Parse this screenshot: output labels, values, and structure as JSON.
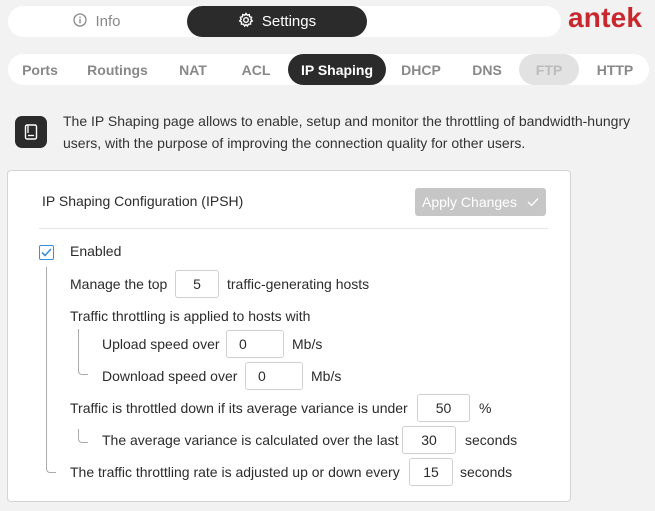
{
  "top_tabs": [
    {
      "label": "Info",
      "icon": "info-icon"
    },
    {
      "label": "Settings",
      "icon": "gear-icon"
    }
  ],
  "brand": "antek",
  "colors": {
    "accent": "#c6282e",
    "dark": "#2b2b2b",
    "check": "#3b8fd9"
  },
  "sub_tabs": [
    "Ports",
    "Routings",
    "NAT",
    "ACL",
    "IP Shaping",
    "DHCP",
    "DNS",
    "FTP",
    "HTTP"
  ],
  "active_sub_tab": "IP Shaping",
  "disabled_sub_tab": "FTP",
  "description": "The IP Shaping page allows to enable, setup and monitor the throttling of bandwidth-hungry users, with the purpose of improving the connection quality for other users.",
  "config": {
    "title": "IP Shaping Configuration (IPSH)",
    "apply_label": "Apply Changes",
    "enabled_label": "Enabled",
    "enabled": true,
    "top_prefix": "Manage the top",
    "top_value": "5",
    "top_suffix": "traffic-generating hosts",
    "throttle_label": "Traffic throttling is applied to hosts with",
    "upload_label": "Upload speed over",
    "upload_value": "0",
    "upload_unit": "Mb/s",
    "download_label": "Download speed over",
    "download_value": "0",
    "download_unit": "Mb/s",
    "variance_label": "Traffic is throttled down if its average variance is under",
    "variance_value": "50",
    "variance_unit": "%",
    "avg_label": "The average variance is calculated over the last",
    "avg_value": "30",
    "avg_unit": "seconds",
    "rate_label": "The traffic throttling rate is adjusted up or down every",
    "rate_value": "15",
    "rate_unit": "seconds"
  }
}
